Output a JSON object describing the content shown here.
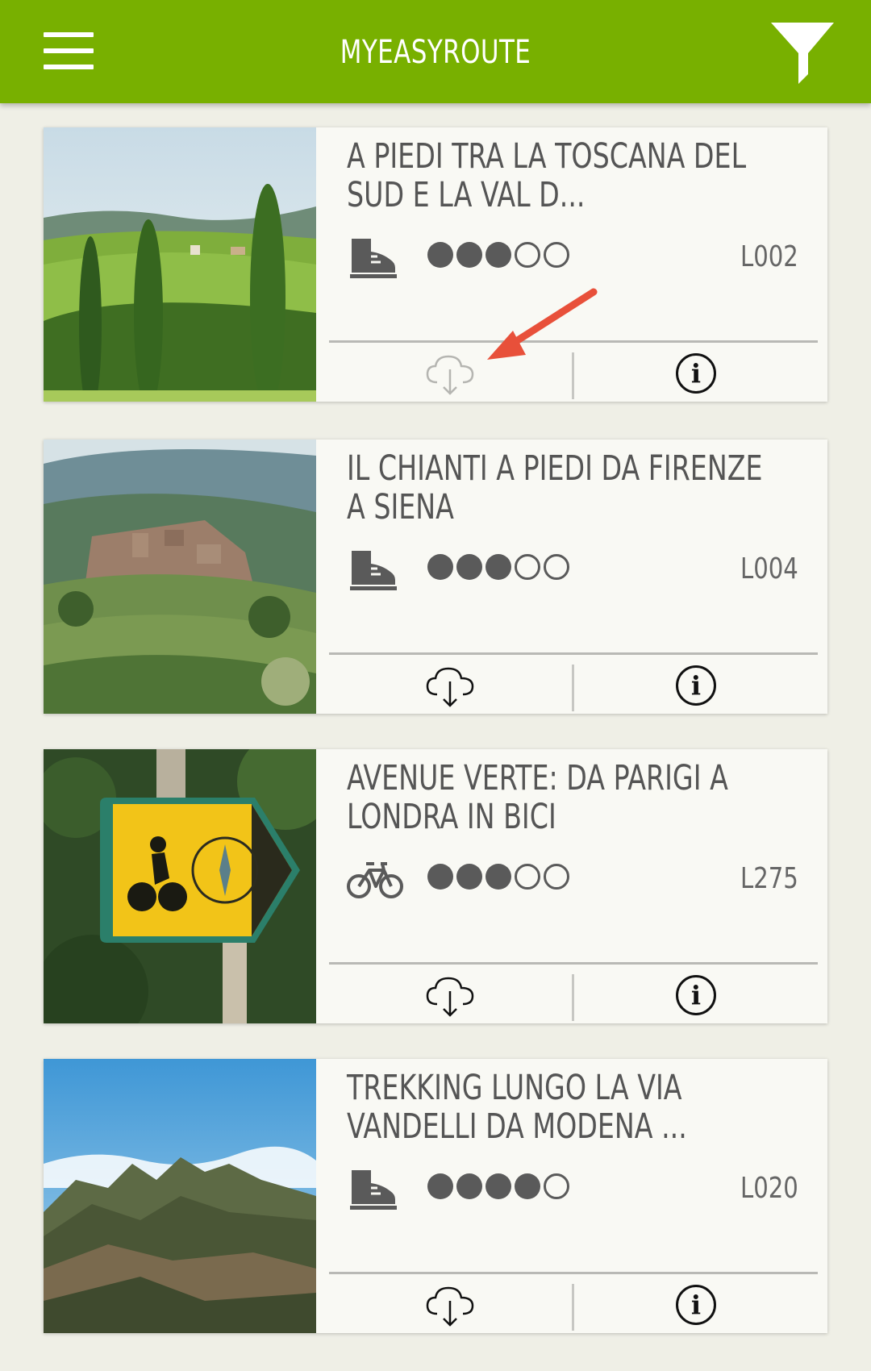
{
  "app": {
    "title": "MYEASYROUTE",
    "accent_color": "#78b000",
    "menu_icon": "hamburger-menu-icon",
    "filter_icon": "filter-funnel-icon"
  },
  "routes": [
    {
      "title_line1": "A PIEDI TRA LA TOSCANA DEL",
      "title_line2": "SUD E LA VAL D...",
      "activity": "hiking-boot-icon",
      "difficulty": 3,
      "difficulty_max": 5,
      "code": "L002",
      "download_state": "disabled"
    },
    {
      "title_line1": "IL CHIANTI A PIEDI DA FIRENZE",
      "title_line2": "A SIENA",
      "activity": "hiking-boot-icon",
      "difficulty": 3,
      "difficulty_max": 5,
      "code": "L004",
      "download_state": "enabled"
    },
    {
      "title_line1": "AVENUE VERTE: DA PARIGI A",
      "title_line2": "LONDRA IN BICI",
      "activity": "bicycle-icon",
      "difficulty": 3,
      "difficulty_max": 5,
      "code": "L275",
      "download_state": "enabled"
    },
    {
      "title_line1": "TREKKING LUNGO LA VIA",
      "title_line2": "VANDELLI DA MODENA ...",
      "activity": "hiking-boot-icon",
      "difficulty": 4,
      "difficulty_max": 5,
      "code": "L020",
      "download_state": "enabled"
    }
  ]
}
